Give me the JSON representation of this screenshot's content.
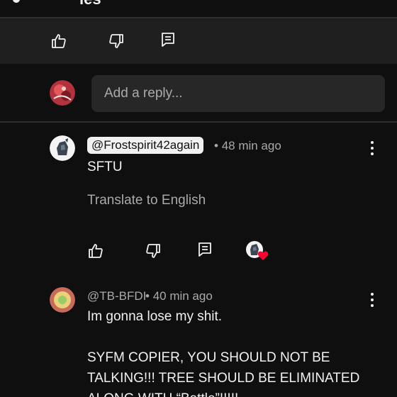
{
  "top": {
    "title_fragment": "ies"
  },
  "composer": {
    "placeholder": "Add a reply..."
  },
  "comments": [
    {
      "handle": "@Frostspirit42again",
      "separator": "•",
      "time": "48 min ago",
      "text": "SFTU",
      "translate_label": "Translate to English",
      "creator_heart": true
    },
    {
      "handle": "@TB-BFDI",
      "separator": "•",
      "time": "40 min ago",
      "lines": [
        "Im gonna lose my shit.",
        "",
        "SYFM COPIER, YOU SHOULD NOT BE",
        "TALKING!!! TREE SHOULD BE ELIMINATED",
        "ALONG WITH “Battle”!!!!!"
      ]
    }
  ],
  "icons": {
    "like": "thumbs-up-icon",
    "dislike": "thumbs-down-icon",
    "reply": "comment-icon",
    "more": "more-vert-icon",
    "heart": "heart-icon"
  },
  "colors": {
    "background": "#0f0f0f",
    "bar": "#1f1f1f",
    "input": "#272727",
    "secondary_text": "#aaaaaa",
    "heart": "#ff0033"
  }
}
